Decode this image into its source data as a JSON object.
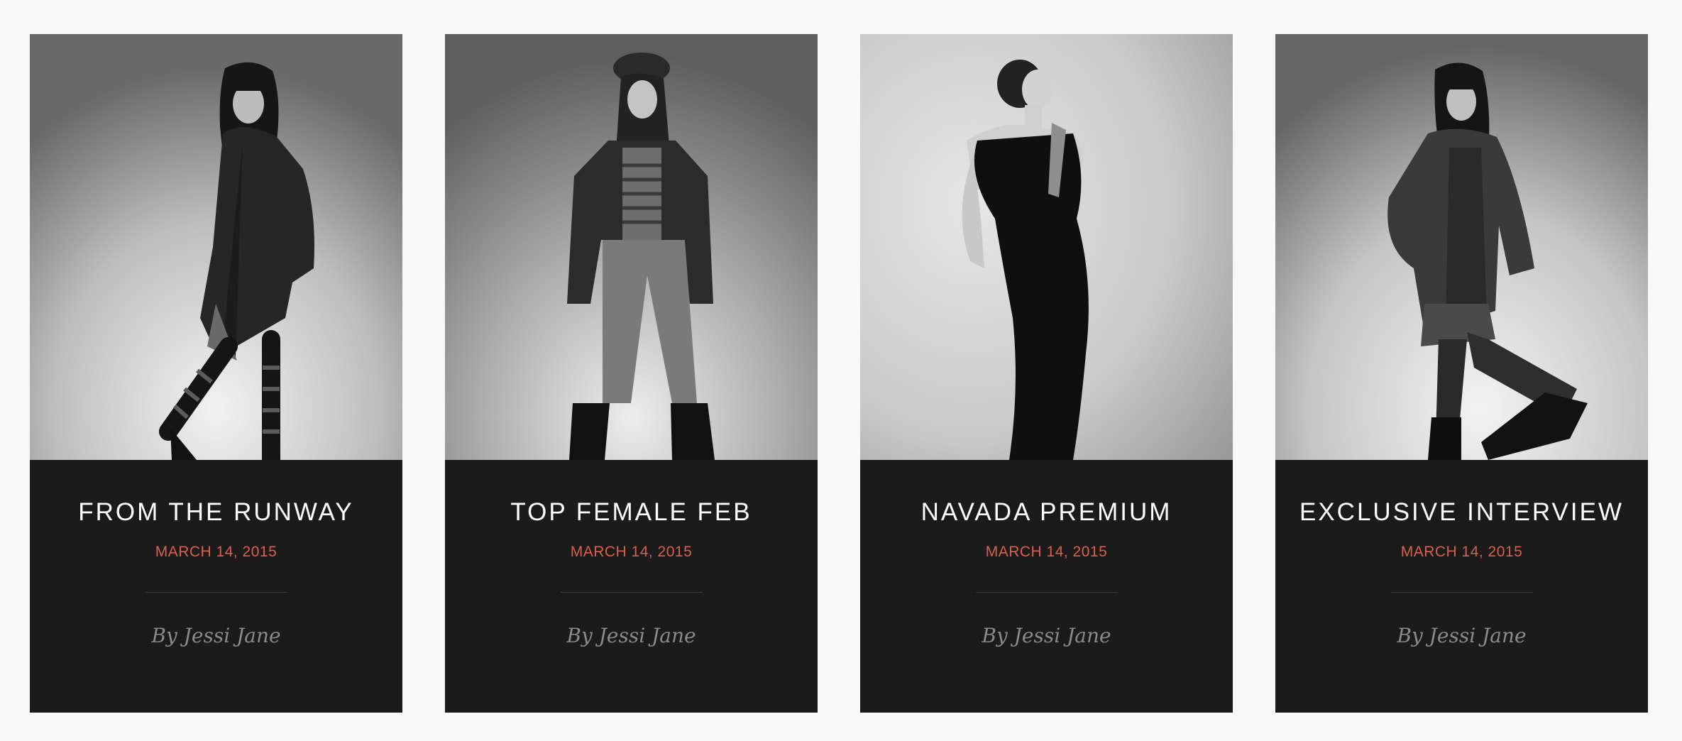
{
  "posts": [
    {
      "title": "FROM THE RUNWAY",
      "date": "MARCH 14, 2015",
      "author": "By Jessi Jane",
      "image": "fashion-model-photo"
    },
    {
      "title": "TOP FEMALE FEB",
      "date": "MARCH 14, 2015",
      "author": "By Jessi Jane",
      "image": "fashion-model-photo"
    },
    {
      "title": "NAVADA PREMIUM",
      "date": "MARCH 14, 2015",
      "author": "By Jessi Jane",
      "image": "fashion-model-photo"
    },
    {
      "title": "EXCLUSIVE INTERVIEW",
      "date": "MARCH 14, 2015",
      "author": "By Jessi Jane",
      "image": "fashion-model-photo"
    }
  ],
  "colors": {
    "page_background": "#f8f8f8",
    "card_background": "#1b1b1c",
    "title": "#ffffff",
    "date_accent": "#d9604a",
    "author": "#8a8a8a"
  }
}
